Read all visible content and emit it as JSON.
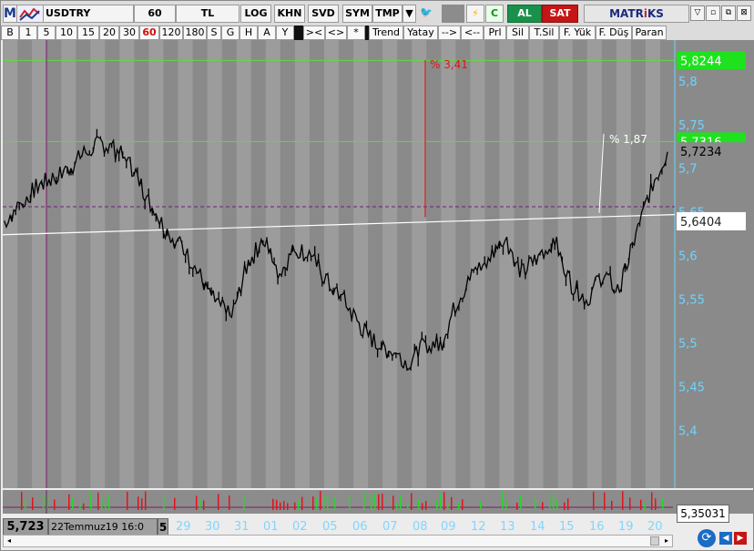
{
  "toolbar": {
    "app_letter": "M",
    "symbol": "USDTRY",
    "period": "60",
    "currency": "TL",
    "log": "LOG",
    "khn": "KHN",
    "svd": "SVD",
    "sym": "SYM",
    "tmp": "TMP",
    "dropdown_glyph": "▼",
    "bird_glyph": "🐦",
    "bolt_glyph": "⚡",
    "c_label": "C",
    "al": "AL",
    "sat": "SAT",
    "brand_prefix": "MATR",
    "brand_mid": "i",
    "brand_suffix": "KS",
    "window_buttons": [
      "▽",
      "▫",
      "⧉",
      "⊠"
    ],
    "icons": {
      "dropdown": "triangle-down-icon",
      "twitter": "bird-icon",
      "bolt": "lightning-icon"
    }
  },
  "periods": [
    {
      "label": "B",
      "width": 20
    },
    {
      "label": "1",
      "width": 20
    },
    {
      "label": "5",
      "width": 20
    },
    {
      "label": "10",
      "width": 24
    },
    {
      "label": "15",
      "width": 24
    },
    {
      "label": "20",
      "width": 22
    },
    {
      "label": "30",
      "width": 22
    },
    {
      "label": "60",
      "width": 22,
      "active": true
    },
    {
      "label": "120",
      "width": 26
    },
    {
      "label": "180",
      "width": 26
    },
    {
      "label": "S",
      "width": 16
    },
    {
      "label": "G",
      "width": 20
    },
    {
      "label": "H",
      "width": 20
    },
    {
      "label": "A",
      "width": 20
    },
    {
      "label": "Y",
      "width": 20
    },
    {
      "label": "",
      "width": 10,
      "black": true
    },
    {
      "label": "><",
      "width": 24
    },
    {
      "label": "<>",
      "width": 24
    },
    {
      "label": "*",
      "width": 20
    },
    {
      "label": "",
      "width": 4,
      "black": true
    },
    {
      "label": "Trend",
      "width": 38
    },
    {
      "label": "Yatay",
      "width": 38
    },
    {
      "label": "-->",
      "width": 25
    },
    {
      "label": "<--",
      "width": 25
    },
    {
      "label": "Prl",
      "width": 25
    },
    {
      "label": "Sil",
      "width": 25
    },
    {
      "label": "T.Sil",
      "width": 33
    },
    {
      "label": "F. Yük",
      "width": 40
    },
    {
      "label": "F. Düş",
      "width": 40
    },
    {
      "label": "Paran",
      "width": 38
    }
  ],
  "colors": {
    "chart_bg": "#8a8a8a",
    "band_light": "#9c9c9c",
    "price_line": "#000000",
    "trend_line": "#ffffff",
    "axis_text": "#6fd4ff",
    "green_line": "#5ddc3a",
    "green_label": "#1de21d",
    "red_marker": "#e0141a",
    "vol_green": "#2bd52b",
    "vol_red": "#e0141a",
    "cursor_line": "#7a1b6a"
  },
  "chart": {
    "y_ticks": [
      5.8,
      5.75,
      5.7,
      5.65,
      5.6,
      5.55,
      5.5,
      5.45,
      5.4
    ],
    "y_range": [
      5.36,
      5.83
    ],
    "pct1_label": "% 3,41",
    "pct2_label": "% 1,87",
    "green_high_label": "5,8244",
    "green_mid_label": "5,7316",
    "last_price_label": "5,7234",
    "trend_label": "5,6404",
    "dash_level": 5.657
  },
  "dates": [
    "29",
    "30",
    "31",
    "01",
    "02",
    "05",
    "06",
    "07",
    "08",
    "09",
    "12",
    "13",
    "14",
    "15",
    "16",
    "19",
    "20"
  ],
  "bottom": {
    "cursor_value": "5,723",
    "cursor_date": "22Temmuz19 16:0",
    "cursor_extra": "5",
    "vol_label": "5,35031",
    "scroll_left": "◂",
    "scroll_right": "▸",
    "refresh": "⟳",
    "nav_left": "◀",
    "nav_right": "▶"
  },
  "chart_data": {
    "type": "line",
    "ylim": [
      5.36,
      5.83
    ],
    "x": [
      "29",
      "30",
      "31",
      "01",
      "02",
      "05",
      "06",
      "07",
      "08",
      "09",
      "12",
      "13",
      "14",
      "15",
      "16",
      "19",
      "20"
    ],
    "series": [
      {
        "values": [
          5.64,
          5.66,
          5.68,
          5.69,
          5.7,
          5.72,
          5.73,
          5.72,
          5.7,
          5.66,
          5.63,
          5.61,
          5.58,
          5.55,
          5.53,
          5.59,
          5.62,
          5.58,
          5.61,
          5.6,
          5.57,
          5.55,
          5.52,
          5.5,
          5.49,
          5.48,
          5.5,
          5.5,
          5.55,
          5.58,
          5.6,
          5.62,
          5.58,
          5.6,
          5.62,
          5.57,
          5.55,
          5.58,
          5.56,
          5.62,
          5.68,
          5.72
        ]
      }
    ],
    "annotations": [
      "% 3,41",
      "% 1,87"
    ]
  }
}
